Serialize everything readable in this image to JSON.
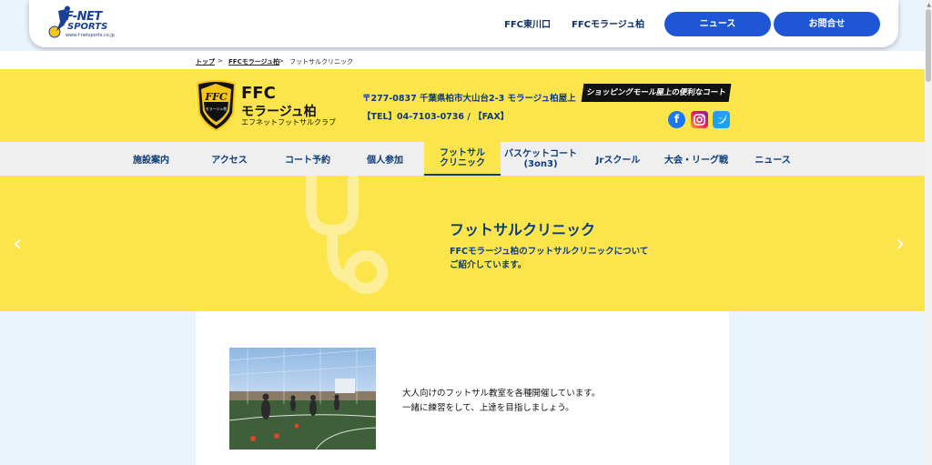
{
  "header": {
    "logo_text": "F-NET",
    "logo_sub": "SPORTS",
    "logo_url": "www.f-netsports.co.jp",
    "links": [
      "FFC東川口",
      "FFCモラージュ柏"
    ],
    "buttons": [
      "ニュース",
      "お問合せ"
    ],
    "accent": "#1e56d6"
  },
  "breadcrumb": {
    "items": [
      "トップ",
      "FFCモラージュ柏",
      "フットサルクリニック"
    ],
    "separator": ">"
  },
  "club": {
    "crest_text": "FFC",
    "crest_sub": "モラージュ柏",
    "name_line1": "FFC",
    "name_line2": "モラージュ柏",
    "name_line3": "エフネットフットサルクラブ",
    "address": "〒277-0837 千葉県柏市大山台2-3 モラージュ柏屋上",
    "tel": "【TEL】04-7103-0736 / 【FAX】",
    "badge": "ショッピングモール屋上の便利なコート",
    "sns": [
      "facebook-icon",
      "instagram-icon",
      "twitter-icon"
    ],
    "bg_color": "#fce44b"
  },
  "nav": {
    "items": [
      "施設案内",
      "アクセス",
      "コート予約",
      "個人参加"
    ],
    "active_line1": "フットサル",
    "active_line2": "クリニック",
    "basket_line1": "バスケットコート",
    "basket_line2": "(3on3)",
    "items_after": [
      "Jrスクール",
      "大会・リーグ戦",
      "ニュース"
    ]
  },
  "hero": {
    "title": "フットサルクリニック",
    "desc_line1": "FFCモラージュ柏のフットサルクリニックについて",
    "desc_line2": "ご紹介しています。",
    "prev": "‹",
    "next": "›"
  },
  "content": {
    "intro_line1": "大人向けのフットサル教室を各種開催しています。",
    "intro_line2": "一緒に練習をして、上達を目指しましょう。"
  }
}
